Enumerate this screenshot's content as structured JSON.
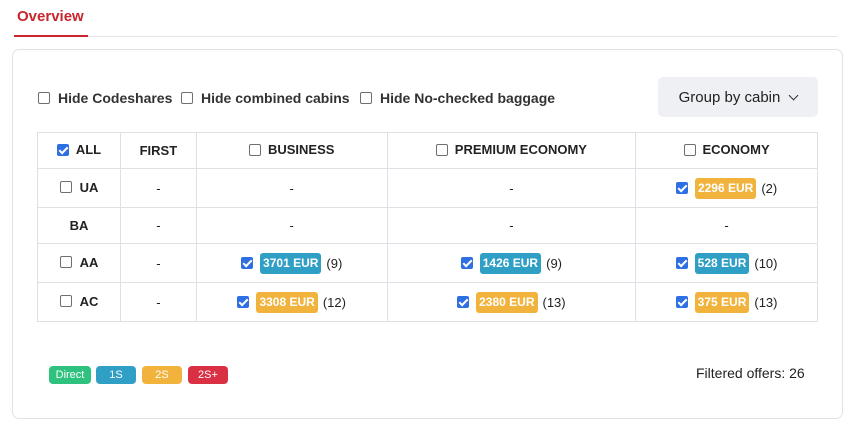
{
  "tabs": {
    "overview": "Overview"
  },
  "filters": {
    "hide_codeshares": "Hide Codeshares",
    "hide_combined_cabins": "Hide combined cabins",
    "hide_no_checked_baggage": "Hide No-checked baggage"
  },
  "group_by": {
    "label": "Group by cabin",
    "icon": "chevron-down-icon"
  },
  "table": {
    "headers": {
      "all": "ALL",
      "first": "FIRST",
      "business": "BUSINESS",
      "premium_economy": "PREMIUM ECONOMY",
      "economy": "ECONOMY"
    },
    "rows": [
      {
        "airline": "UA",
        "first": "-",
        "business": "-",
        "premium_economy": "-",
        "economy": {
          "price": "2296 EUR",
          "count": "(2)"
        }
      },
      {
        "airline": "BA",
        "first": "-",
        "business": "-",
        "premium_economy": "-",
        "economy": "-"
      },
      {
        "airline": "AA",
        "first": "-",
        "business": {
          "price": "3701 EUR",
          "count": "(9)"
        },
        "premium_economy": {
          "price": "1426 EUR",
          "count": "(9)"
        },
        "economy": {
          "price": "528 EUR",
          "count": "(10)"
        }
      },
      {
        "airline": "AC",
        "first": "-",
        "business": {
          "price": "3308 EUR",
          "count": "(12)"
        },
        "premium_economy": {
          "price": "2380 EUR",
          "count": "(13)"
        },
        "economy": {
          "price": "375 EUR",
          "count": "(13)"
        }
      }
    ]
  },
  "legend": [
    {
      "label": "Direct",
      "color": "#2ec27e"
    },
    {
      "label": "1S",
      "color": "#2f9fc6"
    },
    {
      "label": "2S",
      "color": "#f2b33d"
    },
    {
      "label": "2S+",
      "color": "#d93044"
    }
  ],
  "filtered_offers": "Filtered offers: 26",
  "colors": {
    "accent": "#c9252c",
    "checkbox": "#2f6fe4",
    "stops_1": "#2f9fc6",
    "stops_2": "#f2b33d"
  }
}
